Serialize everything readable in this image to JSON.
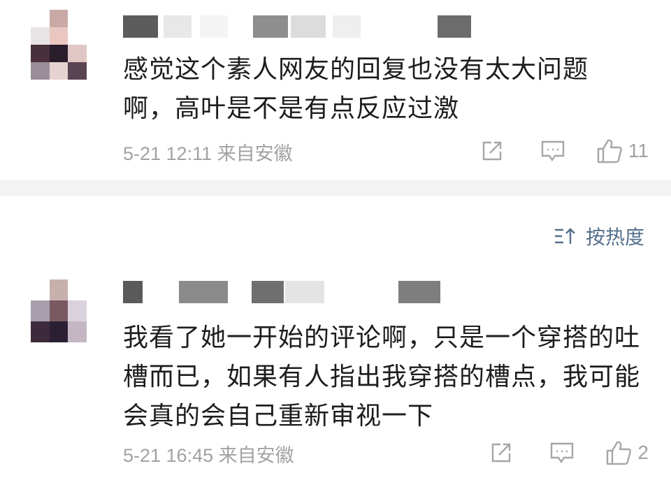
{
  "comments": [
    {
      "text": "感觉这个素人网友的回复也没有太大问题啊，高叶是不是有点反应过激",
      "date": "5-21 12:11",
      "location": "来自安徽",
      "likes": "11"
    },
    {
      "text": "我看了她一开始的评论啊，只是一个穿搭的吐槽而已，如果有人指出我穿搭的槽点，我可能会真的会自己重新审视一下",
      "date": "5-21 16:45",
      "location": "来自安徽",
      "likes": "2"
    }
  ],
  "sort": {
    "label": "按热度"
  },
  "icons": {
    "share": "share-icon",
    "reply": "comment-icon",
    "like": "thumbs-up-icon",
    "sort": "sort-icon"
  },
  "colors": {
    "meta_text": "#a2a2a2",
    "sort_text": "#55708c",
    "divider": "#f3f3f3"
  }
}
